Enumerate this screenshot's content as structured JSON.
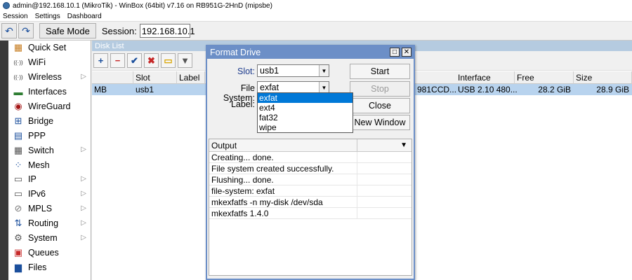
{
  "window": {
    "title": "admin@192.168.10.1 (MikroTik) - WinBox (64bit) v7.16 on RB951G-2HnD (mipsbe)"
  },
  "menu": [
    "Session",
    "Settings",
    "Dashboard"
  ],
  "toolbar": {
    "undo_icon": "↶",
    "redo_icon": "↷",
    "safe_mode_label": "Safe Mode",
    "session_label": "Session:",
    "session_value": "192.168.10.1"
  },
  "sidebar": {
    "items": [
      {
        "label": "Quick Set",
        "icon": "quickset-icon",
        "glyph": "▦",
        "color": "#c67b1e",
        "arrow": false
      },
      {
        "label": "WiFi",
        "icon": "wifi-icon",
        "glyph": "((·))",
        "color": "#333333",
        "arrow": false
      },
      {
        "label": "Wireless",
        "icon": "wireless-icon",
        "glyph": "((·))",
        "color": "#333333",
        "arrow": true
      },
      {
        "label": "Interfaces",
        "icon": "interfaces-icon",
        "glyph": "▬",
        "color": "#2e7d32",
        "arrow": false
      },
      {
        "label": "WireGuard",
        "icon": "wireguard-icon",
        "glyph": "◉",
        "color": "#a31515",
        "arrow": false
      },
      {
        "label": "Bridge",
        "icon": "bridge-icon",
        "glyph": "⊞",
        "color": "#1b4f9c",
        "arrow": false
      },
      {
        "label": "PPP",
        "icon": "ppp-icon",
        "glyph": "▤",
        "color": "#1b4f9c",
        "arrow": false
      },
      {
        "label": "Switch",
        "icon": "switch-icon",
        "glyph": "▦",
        "color": "#555555",
        "arrow": true
      },
      {
        "label": "Mesh",
        "icon": "mesh-icon",
        "glyph": "⁘",
        "color": "#1b4f9c",
        "arrow": false
      },
      {
        "label": "IP",
        "icon": "ip-icon",
        "glyph": "▭",
        "color": "#555555",
        "arrow": true
      },
      {
        "label": "IPv6",
        "icon": "ipv6-icon",
        "glyph": "▭",
        "color": "#555555",
        "arrow": true
      },
      {
        "label": "MPLS",
        "icon": "mpls-icon",
        "glyph": "⊘",
        "color": "#777777",
        "arrow": true
      },
      {
        "label": "Routing",
        "icon": "routing-icon",
        "glyph": "⇅",
        "color": "#1b4f9c",
        "arrow": true
      },
      {
        "label": "System",
        "icon": "system-icon",
        "glyph": "⚙",
        "color": "#555555",
        "arrow": true
      },
      {
        "label": "Queues",
        "icon": "queues-icon",
        "glyph": "▣",
        "color": "#c62828",
        "arrow": false
      },
      {
        "label": "Files",
        "icon": "files-icon",
        "glyph": "▆",
        "color": "#1b4f9c",
        "arrow": false
      }
    ]
  },
  "disk_list": {
    "title": "Disk List",
    "toolbar": [
      "+",
      "−",
      "✔",
      "✖",
      "▭",
      "▼"
    ],
    "columns": [
      "Slot",
      "Label",
      "Interface",
      "Free",
      "Size"
    ],
    "row": {
      "partial_left": "MB",
      "slot": "usb1",
      "partial_mid": "981CCD...",
      "interface": "USB 2.10 480...",
      "free": "28.2 GiB",
      "size": "28.9 GiB"
    }
  },
  "format_dialog": {
    "title": "Format Drive",
    "slot_label": "Slot:",
    "slot_value": "usb1",
    "fs_label": "File System:",
    "fs_value": "exfat",
    "label_label": "Label:",
    "fs_options": [
      "exfat",
      "ext4",
      "fat32",
      "wipe"
    ],
    "selected_option": "exfat",
    "buttons": {
      "start": "Start",
      "stop": "Stop",
      "close": "Close",
      "new_window": "New Window"
    },
    "output_header": "Output",
    "output_lines": [
      "Creating... done.",
      "File system created successfully.",
      "Flushing... done.",
      "file-system: exfat",
      "mkexfatfs -n my-disk /dev/sda",
      "mkexfatfs 1.4.0"
    ]
  }
}
